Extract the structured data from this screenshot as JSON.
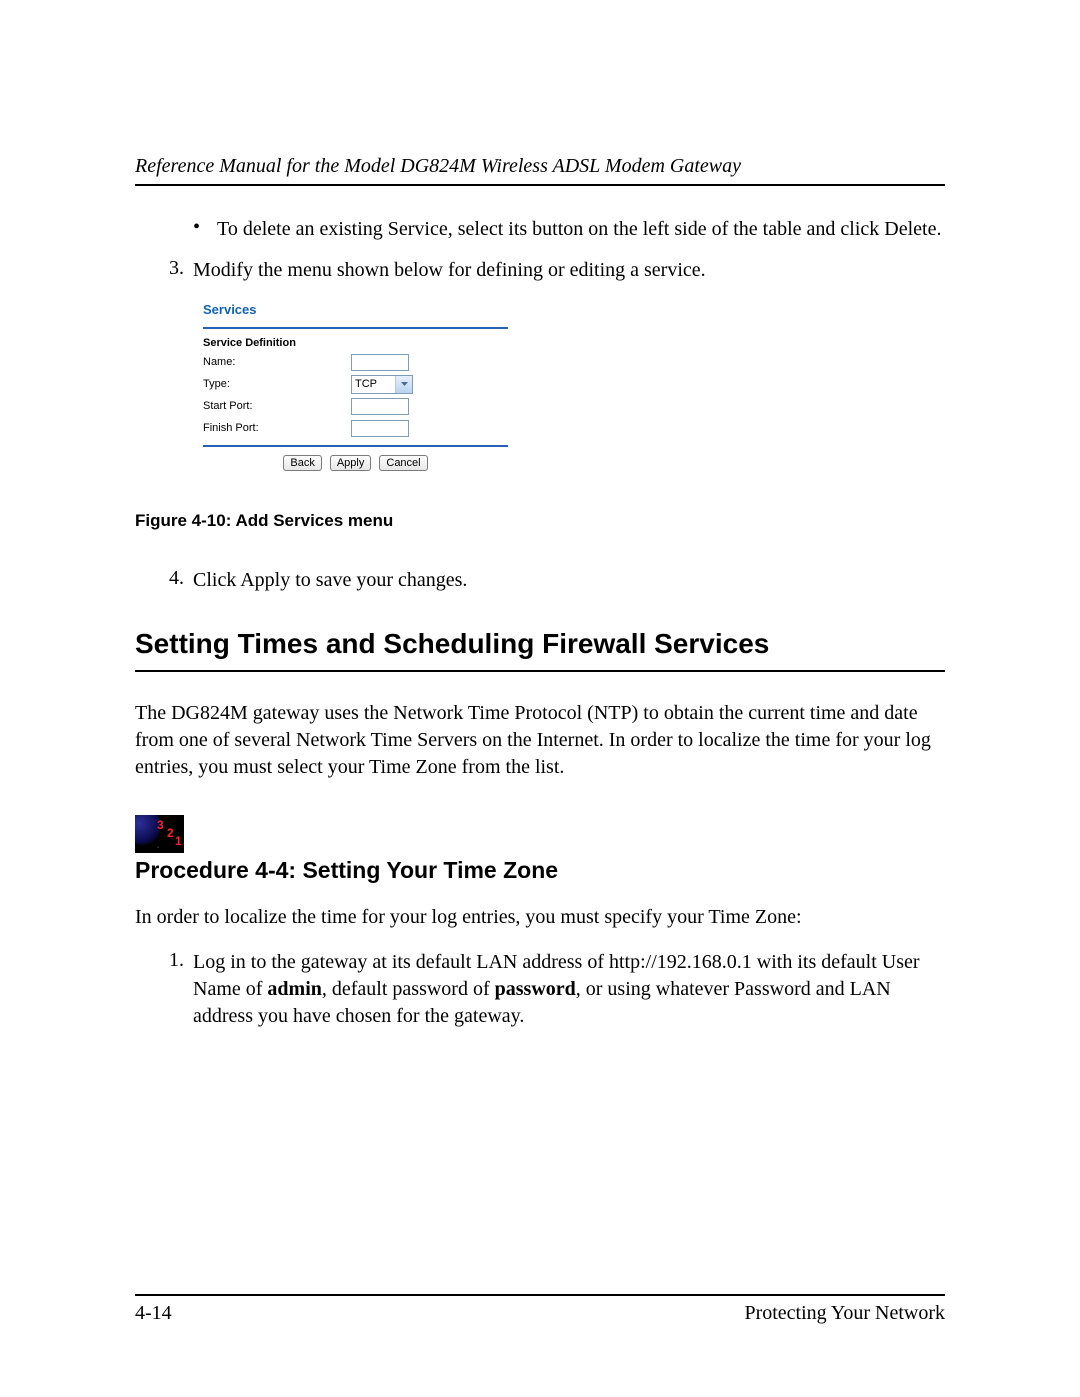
{
  "header": {
    "title": "Reference Manual for the Model DG824M Wireless ADSL Modem Gateway"
  },
  "body": {
    "bullet1": "To delete an existing Service, select its button on the left side of the table and click Delete.",
    "step3_num": "3.",
    "step3": "Modify the menu shown below for defining or editing a service.",
    "step4_num": "4.",
    "step4": "Click Apply to save your changes.",
    "h1": "Setting Times and Scheduling Firewall Services",
    "para1": "The DG824M gateway uses the Network Time Protocol (NTP) to obtain the current time and date from one of several Network Time Servers on the Internet. In order to localize the time for your log entries, you must select your Time Zone from the list.",
    "h2": "Procedure 4-4:  Setting Your Time Zone",
    "para2": "In order to localize the time for your log entries, you must specify your Time Zone:",
    "proc1_num": "1.",
    "proc1_a": "Log in to the gateway at its default LAN address of http://192.168.0.1 with its default User Name of ",
    "proc1_b": "admin",
    "proc1_c": ", default password of ",
    "proc1_d": "password",
    "proc1_e": ", or using whatever Password and LAN address you have chosen for the gateway."
  },
  "figure": {
    "panel_title": "Services",
    "section": "Service Definition",
    "labels": {
      "name": "Name:",
      "type": "Type:",
      "start": "Start Port:",
      "finish": "Finish Port:"
    },
    "type_value": "TCP",
    "buttons": {
      "back": "Back",
      "apply": "Apply",
      "cancel": "Cancel"
    },
    "caption": "Figure 4-10: Add Services menu"
  },
  "footer": {
    "left": "4-14",
    "right": "Protecting Your Network"
  }
}
